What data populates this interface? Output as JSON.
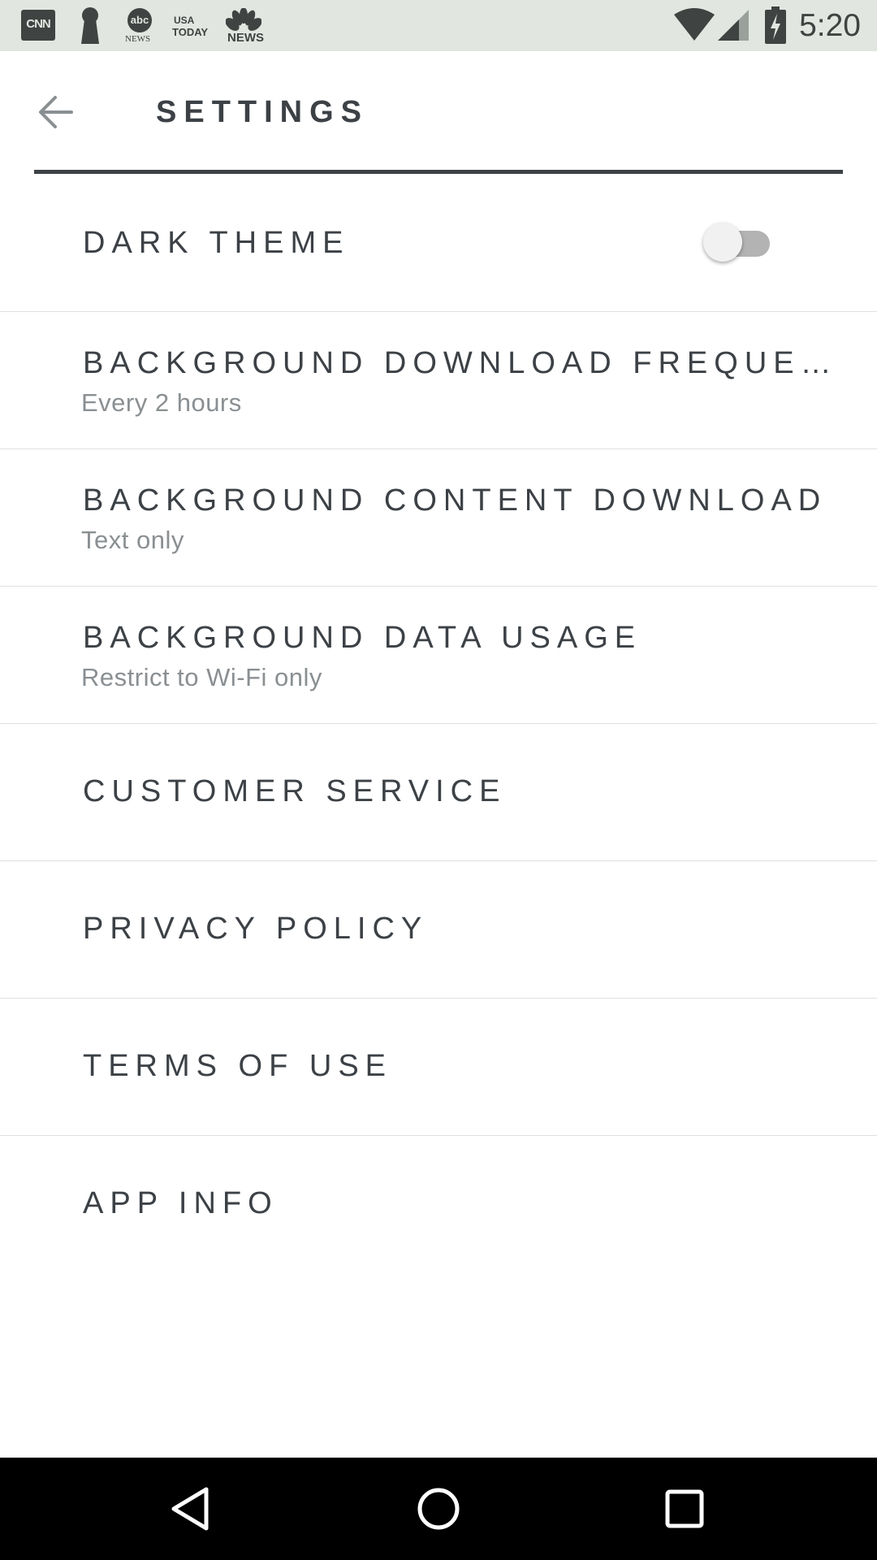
{
  "status_bar": {
    "time": "5:20",
    "notification_icons": [
      "cnn-icon",
      "keyhole-icon",
      "abc-news-icon",
      "usa-today-icon",
      "nbc-news-icon"
    ],
    "abc_label": "NEWS",
    "usa_today_label_1": "USA",
    "usa_today_label_2": "TODAY",
    "nbc_label": "NEWS",
    "cnn_label": "CNN"
  },
  "app_bar": {
    "title": "SETTINGS",
    "back_icon": "arrow-left-icon"
  },
  "settings": {
    "dark_theme": {
      "label": "DARK THEME",
      "enabled": false
    },
    "background_download_frequency": {
      "label": "BACKGROUND DOWNLOAD FREQUENCY",
      "value": "Every 2 hours"
    },
    "background_content_download": {
      "label": "BACKGROUND CONTENT DOWNLOAD",
      "value": "Text only"
    },
    "background_data_usage": {
      "label": "BACKGROUND DATA USAGE",
      "value": "Restrict to Wi-Fi only"
    },
    "customer_service": {
      "label": "CUSTOMER SERVICE"
    },
    "privacy_policy": {
      "label": "PRIVACY POLICY"
    },
    "terms_of_use": {
      "label": "TERMS OF USE"
    },
    "app_info": {
      "label": "APP INFO"
    }
  },
  "nav_bar": {
    "buttons": [
      "back-triangle-icon",
      "home-circle-icon",
      "recents-square-icon"
    ]
  },
  "colors": {
    "status_bar_bg": "#e1e6e1",
    "text_primary": "#3c4146",
    "text_secondary": "#8a8f92",
    "divider": "#dde0e2",
    "nav_bar_bg": "#000000"
  }
}
